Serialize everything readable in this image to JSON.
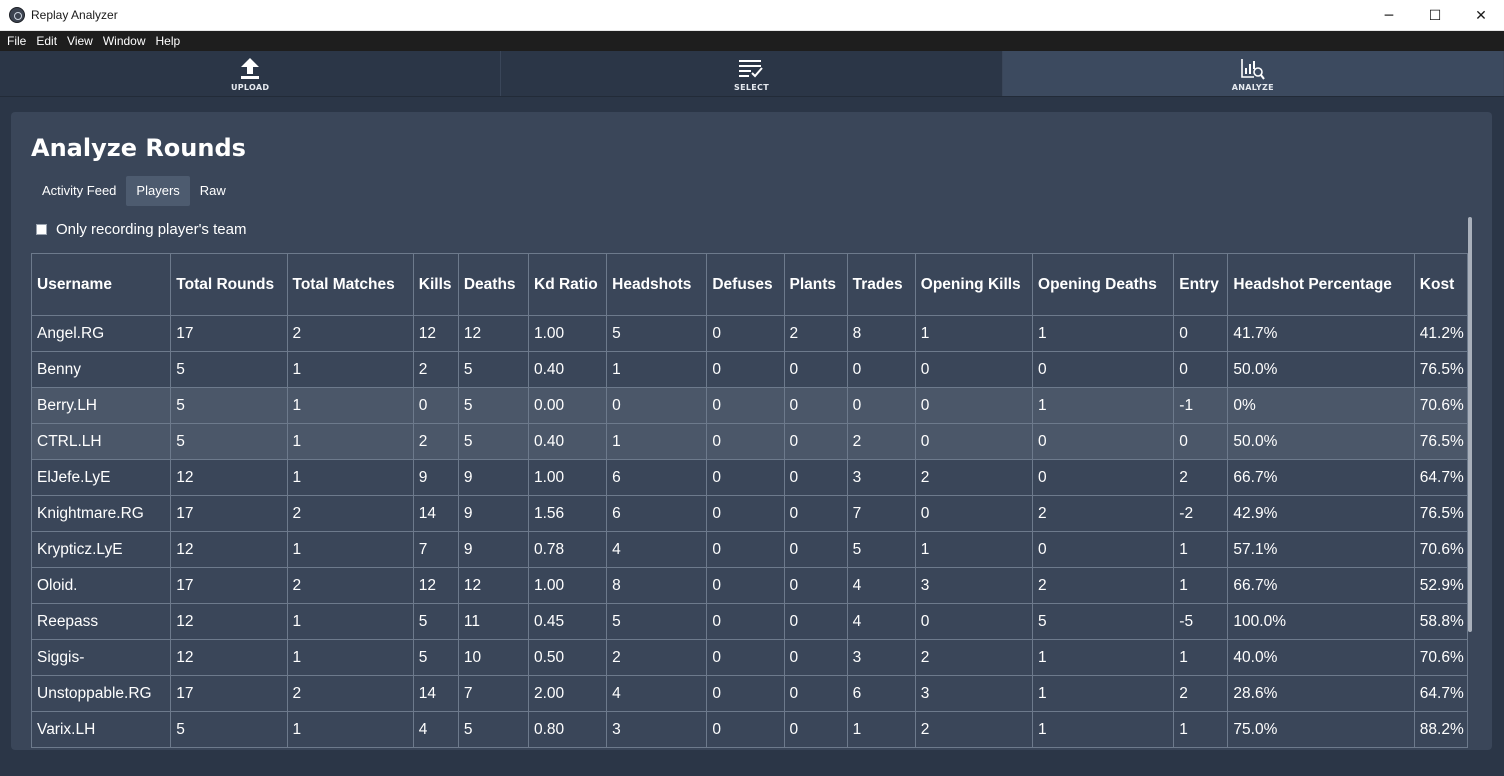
{
  "window": {
    "title": "Replay Analyzer",
    "controls": {
      "minimize": "─",
      "maximize": "☐",
      "close": "✕"
    }
  },
  "menu": [
    "File",
    "Edit",
    "View",
    "Window",
    "Help"
  ],
  "nav": [
    {
      "label": "UPLOAD",
      "icon": "upload-icon",
      "active": false
    },
    {
      "label": "SELECT",
      "icon": "checklist-icon",
      "active": false
    },
    {
      "label": "ANALYZE",
      "icon": "chart-search-icon",
      "active": true
    }
  ],
  "page": {
    "title": "Analyze Rounds",
    "tabs": [
      {
        "label": "Activity Feed",
        "active": false
      },
      {
        "label": "Players",
        "active": true
      },
      {
        "label": "Raw",
        "active": false
      }
    ],
    "filter_label": "Only recording player's team",
    "filter_checked": false
  },
  "table": {
    "columns": [
      "Username",
      "Total Rounds",
      "Total Matches",
      "Kills",
      "Deaths",
      "Kd Ratio",
      "Headshots",
      "Defuses",
      "Plants",
      "Trades",
      "Opening Kills",
      "Opening Deaths",
      "Entry",
      "Headshot Percentage",
      "Kost"
    ],
    "rows": [
      [
        "Angel.RG",
        "17",
        "2",
        "12",
        "12",
        "1.00",
        "5",
        "0",
        "2",
        "8",
        "1",
        "1",
        "0",
        "41.7%",
        "41.2%"
      ],
      [
        "Benny",
        "5",
        "1",
        "2",
        "5",
        "0.40",
        "1",
        "0",
        "0",
        "0",
        "0",
        "0",
        "0",
        "50.0%",
        "76.5%"
      ],
      [
        "Berry.LH",
        "5",
        "1",
        "0",
        "5",
        "0.00",
        "0",
        "0",
        "0",
        "0",
        "0",
        "1",
        "-1",
        "0%",
        "70.6%"
      ],
      [
        "CTRL.LH",
        "5",
        "1",
        "2",
        "5",
        "0.40",
        "1",
        "0",
        "0",
        "2",
        "0",
        "0",
        "0",
        "50.0%",
        "76.5%"
      ],
      [
        "ElJefe.LyE",
        "12",
        "1",
        "9",
        "9",
        "1.00",
        "6",
        "0",
        "0",
        "3",
        "2",
        "0",
        "2",
        "66.7%",
        "64.7%"
      ],
      [
        "Knightmare.RG",
        "17",
        "2",
        "14",
        "9",
        "1.56",
        "6",
        "0",
        "0",
        "7",
        "0",
        "2",
        "-2",
        "42.9%",
        "76.5%"
      ],
      [
        "Krypticz.LyE",
        "12",
        "1",
        "7",
        "9",
        "0.78",
        "4",
        "0",
        "0",
        "5",
        "1",
        "0",
        "1",
        "57.1%",
        "70.6%"
      ],
      [
        "Oloid.",
        "17",
        "2",
        "12",
        "12",
        "1.00",
        "8",
        "0",
        "0",
        "4",
        "3",
        "2",
        "1",
        "66.7%",
        "52.9%"
      ],
      [
        "Reepass",
        "12",
        "1",
        "5",
        "11",
        "0.45",
        "5",
        "0",
        "0",
        "4",
        "0",
        "5",
        "-5",
        "100.0%",
        "58.8%"
      ],
      [
        "Siggis-",
        "12",
        "1",
        "5",
        "10",
        "0.50",
        "2",
        "0",
        "0",
        "3",
        "2",
        "1",
        "1",
        "40.0%",
        "70.6%"
      ],
      [
        "Unstoppable.RG",
        "17",
        "2",
        "14",
        "7",
        "2.00",
        "4",
        "0",
        "0",
        "6",
        "3",
        "1",
        "2",
        "28.6%",
        "64.7%"
      ],
      [
        "Varix.LH",
        "5",
        "1",
        "4",
        "5",
        "0.80",
        "3",
        "0",
        "0",
        "1",
        "2",
        "1",
        "1",
        "75.0%",
        "88.2%"
      ]
    ],
    "highlighted_rows": [
      2,
      3
    ]
  }
}
